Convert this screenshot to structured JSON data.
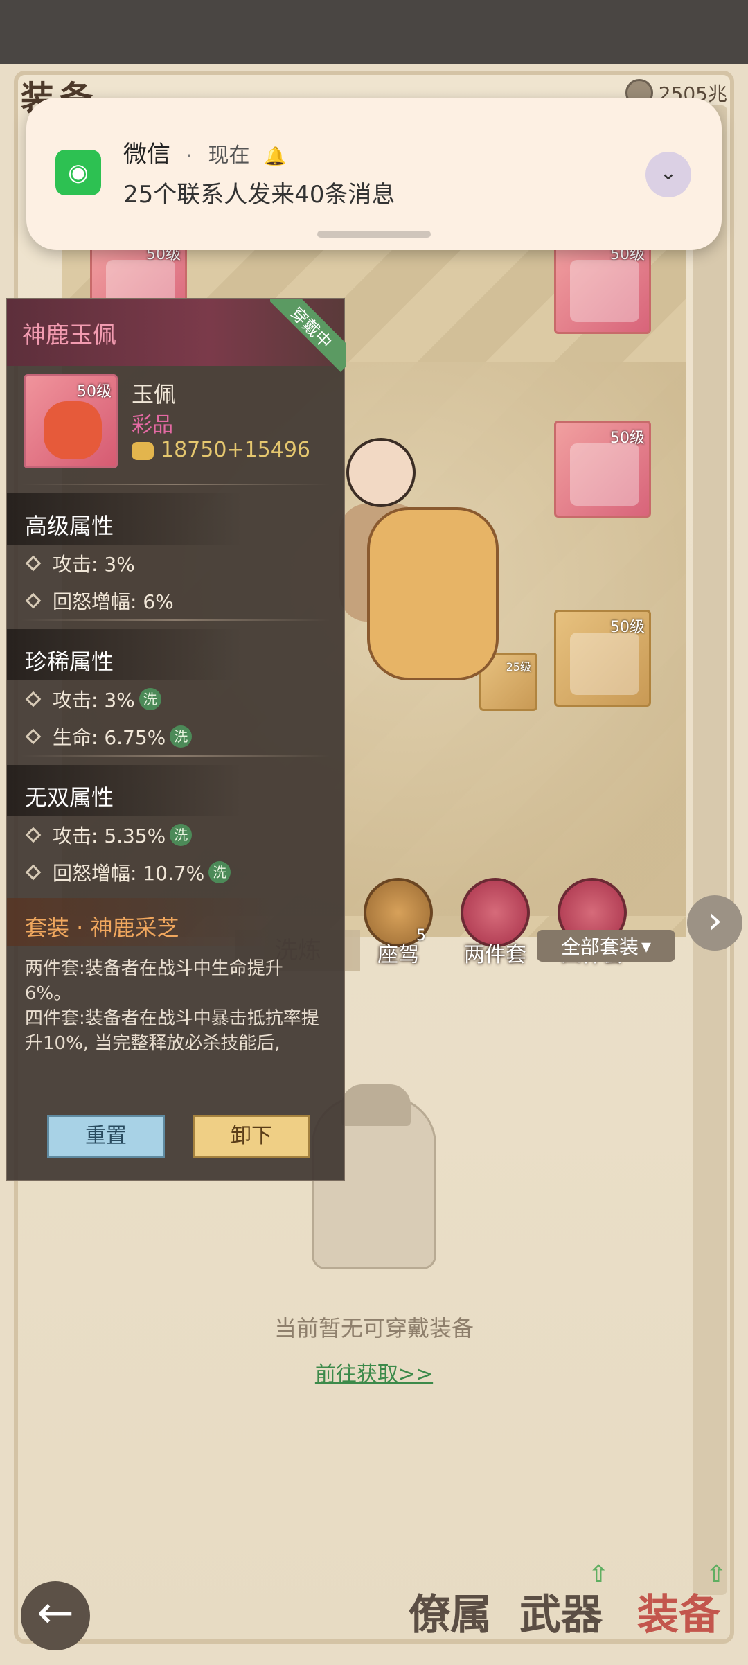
{
  "notification": {
    "app": "微信",
    "separator": "·",
    "time": "现在",
    "message": "25个联系人发来40条消息",
    "icon": "wechat-icon",
    "accent": "#2dc152"
  },
  "header": {
    "title": "装备",
    "currency": "2505兆"
  },
  "slots": [
    {
      "level": "50级"
    },
    {
      "level": "50级"
    },
    {
      "level": "50级"
    },
    {
      "level": "50级"
    },
    {
      "level": "25级"
    }
  ],
  "action_tabs": {
    "mount_label": "座驾",
    "mount_count": "5",
    "two_set_label": "两件套",
    "four_set_label": "四件套"
  },
  "filter": {
    "suit_dropdown": "全部套装",
    "left_tab": "洗炼"
  },
  "empty_state": {
    "text": "当前暂无可穿戴装备",
    "link": "前往获取>>"
  },
  "bottom_nav": {
    "items": [
      "僚属",
      "武器",
      "装备"
    ],
    "active": "装备"
  },
  "tooltip": {
    "title": "神鹿玉佩",
    "wearing_tag": "穿戴中",
    "item": {
      "level": "50级",
      "name": "玉佩",
      "quality": "彩品",
      "power": "18750+15496"
    },
    "advanced": {
      "title": "高级属性",
      "attrs": [
        "攻击: 3%",
        "回怒增幅: 6%"
      ]
    },
    "rare": {
      "title": "珍稀属性",
      "attrs": [
        "攻击: 3%",
        "生命: 6.75%"
      ],
      "wash_label": "洗"
    },
    "peerless": {
      "title": "无双属性",
      "attrs": [
        "攻击: 5.35%",
        "回怒增幅: 10.7%"
      ],
      "wash_label": "洗"
    },
    "suit": {
      "title": "套装 · 神鹿采芝",
      "desc_two": "两件套:装备者在战斗中生命提升6%。",
      "desc_four": "四件套:装备者在战斗中暴击抵抗率提升10%, 当完整释放必杀技能后,"
    },
    "buttons": {
      "reset": "重置",
      "unequip": "卸下"
    }
  }
}
